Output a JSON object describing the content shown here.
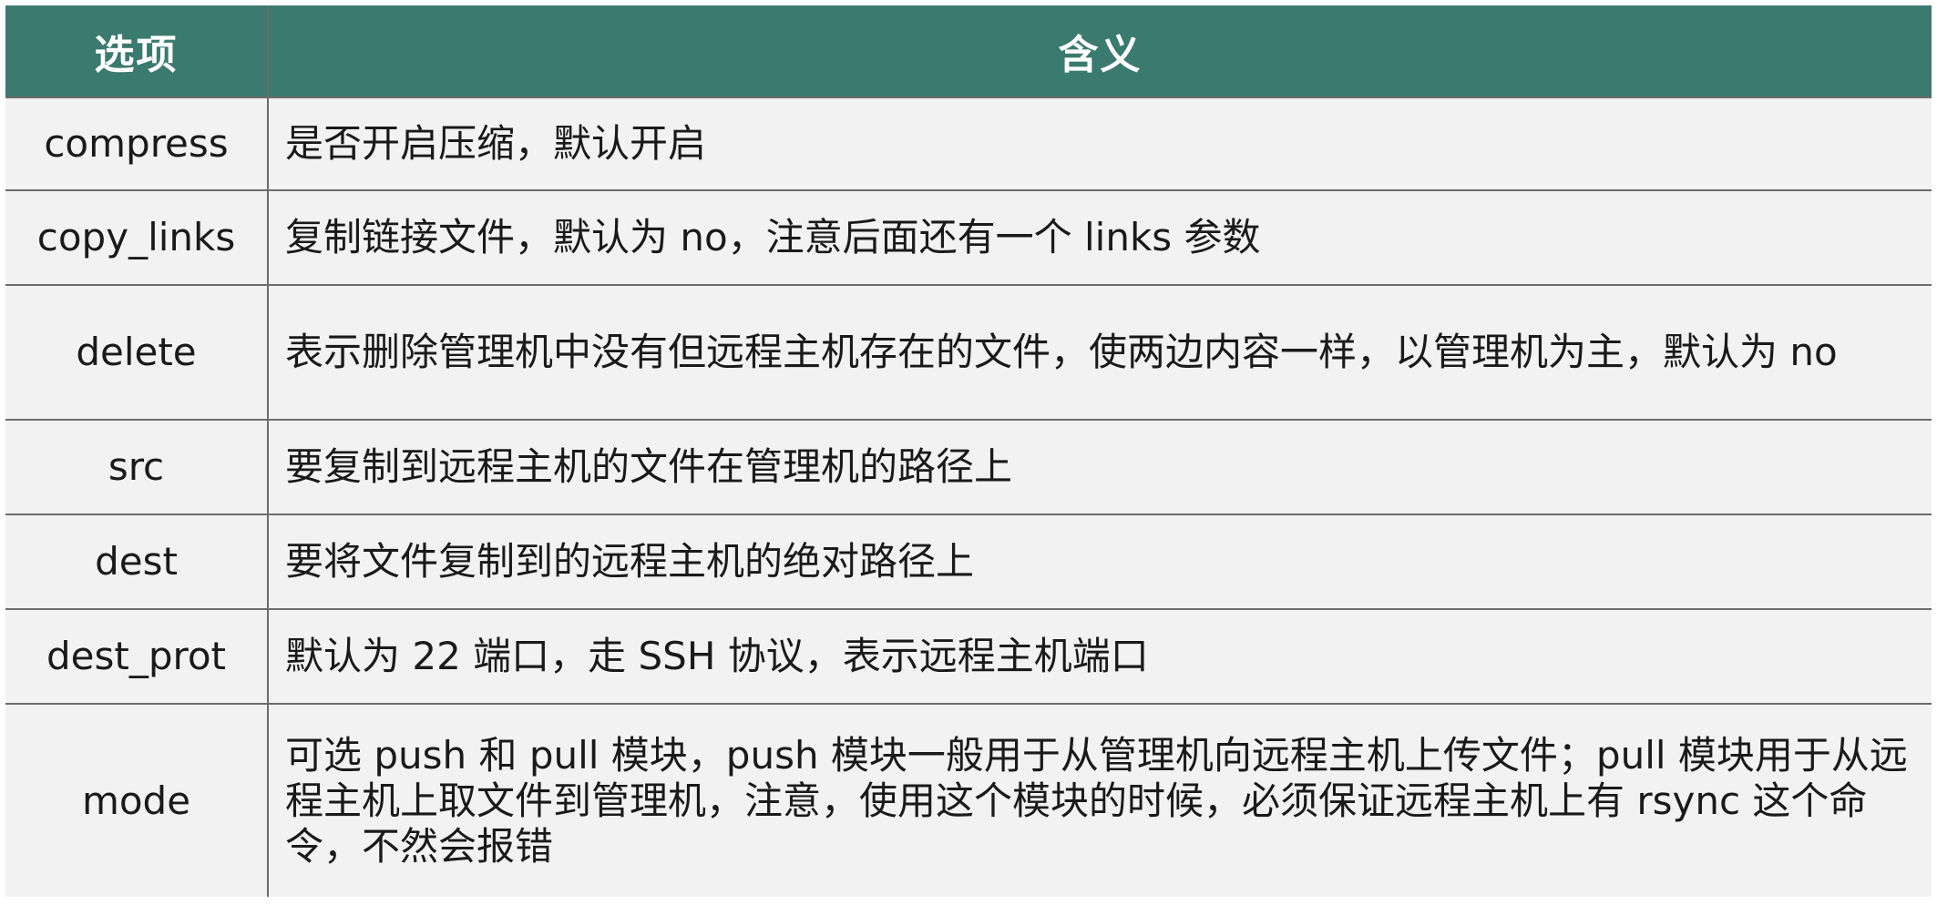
{
  "table": {
    "headers": [
      "选项",
      "含义"
    ],
    "rows": [
      {
        "option": "compress",
        "meaning": "是否开启压缩，默认开启"
      },
      {
        "option": "copy_links",
        "meaning": "复制链接文件，默认为 no，注意后面还有一个 links 参数"
      },
      {
        "option": "delete",
        "meaning": "表示删除管理机中没有但远程主机存在的文件，使两边内容一样，以管理机为主，默认为 no"
      },
      {
        "option": "src",
        "meaning": "要复制到远程主机的文件在管理机的路径上"
      },
      {
        "option": "dest",
        "meaning": "要将文件复制到的远程主机的绝对路径上"
      },
      {
        "option": "dest_prot",
        "meaning": "默认为 22 端口，走 SSH 协议，表示远程主机端口"
      },
      {
        "option": "mode",
        "meaning": "可选 push 和 pull 模块，push 模块一般用于从管理机向远程主机上传文件；pull 模块用于从远程主机上取文件到管理机，注意，使用这个模块的时候，必须保证远程主机上有 rsync 这个命令，不然会报错"
      }
    ]
  },
  "colors": {
    "header_bg": "#3b7a6f",
    "header_text": "#ffffff",
    "cell_bg": "#f2f2f2",
    "border": "#6c6c6c"
  }
}
